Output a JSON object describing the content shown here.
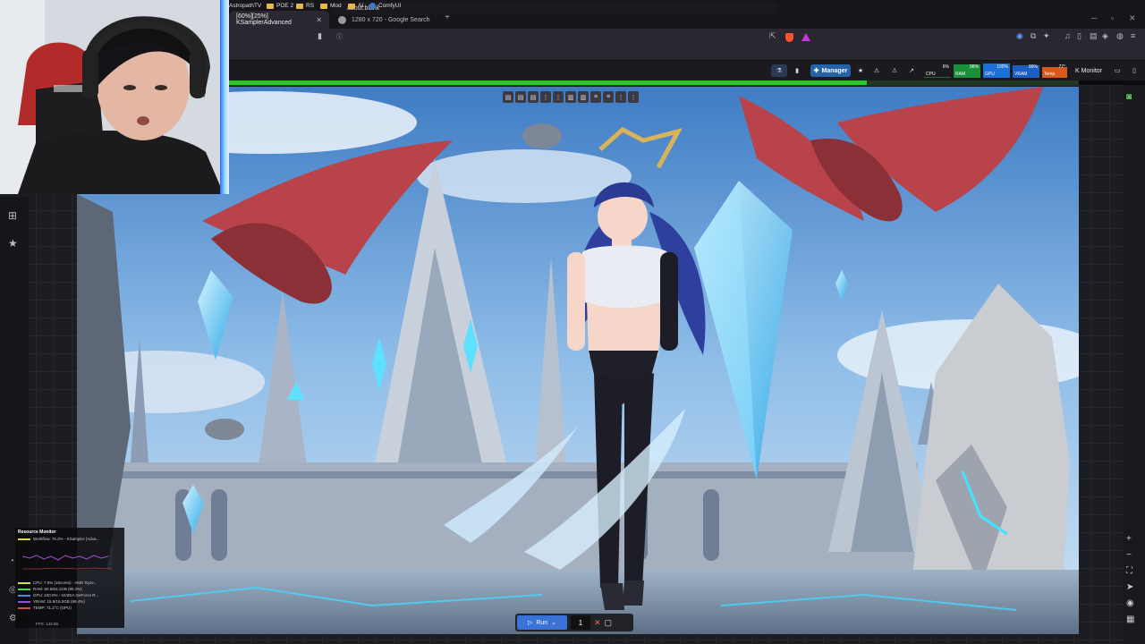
{
  "browser": {
    "tabs": [
      {
        "label": "[60%][25%] KSamplerAdvanced",
        "active": true
      },
      {
        "label": "1280 x 720 - Google Search",
        "active": false
      }
    ],
    "url": "about:blank",
    "bookmarks": [
      "AstropathTV",
      "POE 2",
      "RS",
      "Mod",
      "AI",
      "ComfyUI"
    ]
  },
  "comfy": {
    "manager_label": "Manager",
    "monitor_label": "Monitor",
    "gauges": [
      {
        "label": "CPU",
        "value": "6%",
        "fill": 0.06,
        "color": "#1e6b2a"
      },
      {
        "label": "RAM",
        "value": "96%",
        "fill": 0.96,
        "color": "#1b8f3a"
      },
      {
        "label": "GPU",
        "value": "100%",
        "fill": 1.0,
        "color": "#1b6fd6"
      },
      {
        "label": "VRAM",
        "value": "89%",
        "fill": 0.89,
        "color": "#1b5fc0"
      },
      {
        "label": "Temp",
        "value": "77°",
        "fill": 0.77,
        "color": "#d65a1b"
      }
    ],
    "progress": 0.75
  },
  "run": {
    "label": "Run",
    "batch": "1"
  },
  "resource_monitor": {
    "title": "Resource Monitor",
    "workflow": "Workflow: 76.2% - KSampler (Adva...",
    "lines": [
      {
        "text": "CPU: 7.8% (16cores) - AMD Ryze...",
        "color": "#d8d84a"
      },
      {
        "text": "RAM: 60.6/63.1GB (95.4%)",
        "color": "#4ad84a"
      },
      {
        "text": "GPU: 100.0% - NVIDIA GeForce R...",
        "color": "#4a8ad8"
      },
      {
        "text": "VRAM: 15.9/16.0GB (99.4%)",
        "color": "#a04ad8"
      },
      {
        "text": "TEMP: 71.2°C (GPU)",
        "color": "#d84a4a"
      }
    ],
    "fps": "FPS: 142.86"
  },
  "colors": {
    "accent": "#2563a8",
    "progress": "#27c927",
    "run": "#3a72d6"
  }
}
